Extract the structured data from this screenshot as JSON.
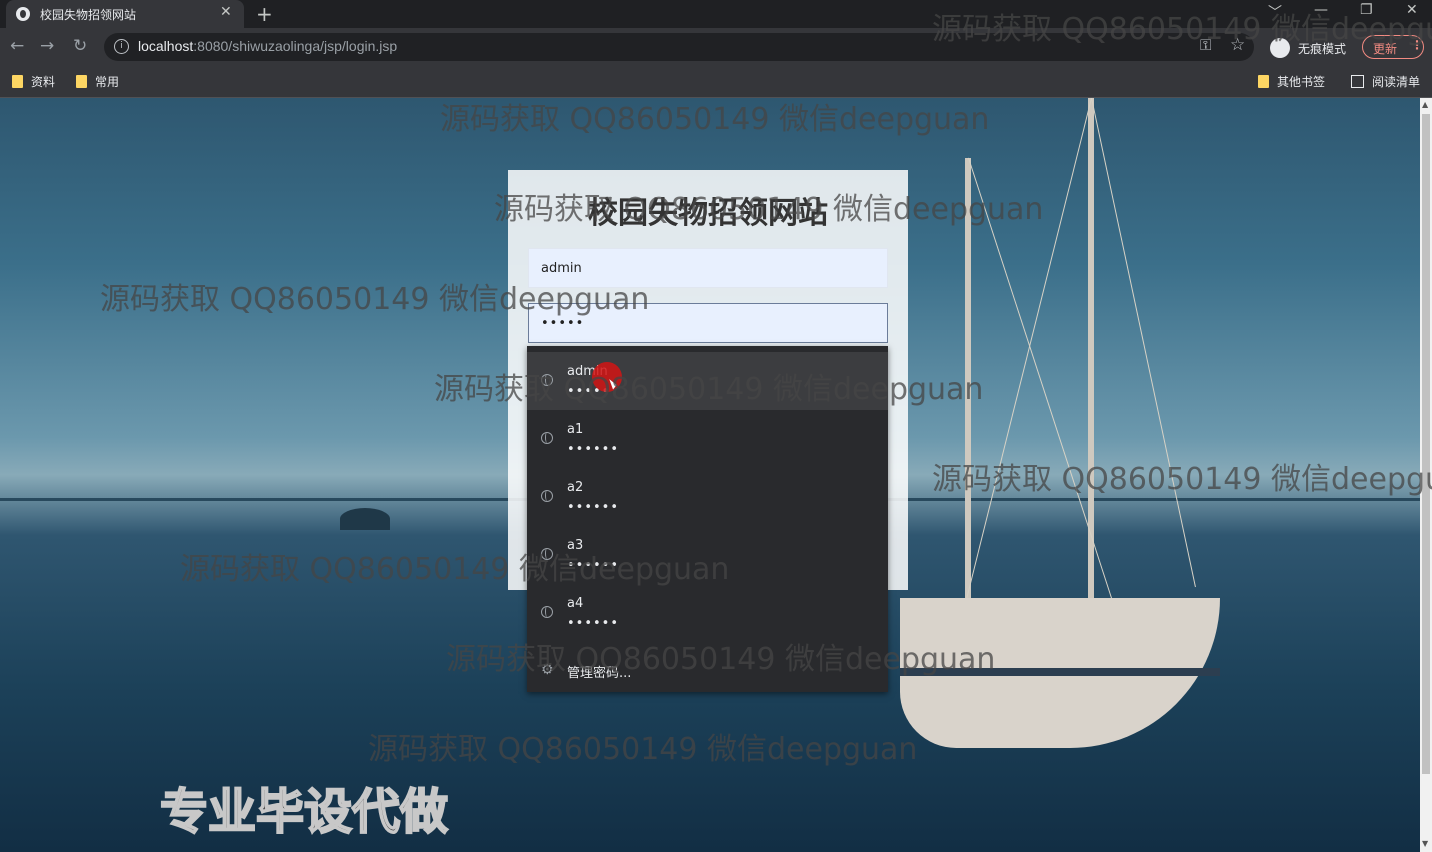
{
  "browser": {
    "tab_title": "校园失物招领网站",
    "tab_close": "✕",
    "new_tab": "+",
    "url_host": "localhost",
    "url_rest": ":8080/shiwuzaolinga/jsp/login.jsp",
    "incognito_label": "无痕模式",
    "update_label": "更新",
    "window_controls": [
      "﹀",
      "—",
      "❐",
      "✕"
    ],
    "bookmarks": [
      "资料",
      "常用"
    ],
    "bookmarks_right": [
      "其他书签",
      "阅读清单"
    ]
  },
  "login": {
    "title": "校园失物招领网站",
    "username_value": "admin",
    "password_value": "•••••"
  },
  "autofill": {
    "items": [
      {
        "user": "admin",
        "pass": "•••••"
      },
      {
        "user": "a1",
        "pass": "••••••"
      },
      {
        "user": "a2",
        "pass": "••••••"
      },
      {
        "user": "a3",
        "pass": "••••••"
      },
      {
        "user": "a4",
        "pass": "••••••"
      }
    ],
    "manage_label": "管理密码..."
  },
  "watermark": {
    "text": "源码获取 QQ86050149 微信deepguan",
    "big_text": "专业毕设代做"
  },
  "colors": {
    "chrome_dark": "#202124",
    "chrome_tab": "#35363a",
    "dropdown_bg": "#292a2d",
    "accent_red": "#f28b82"
  }
}
